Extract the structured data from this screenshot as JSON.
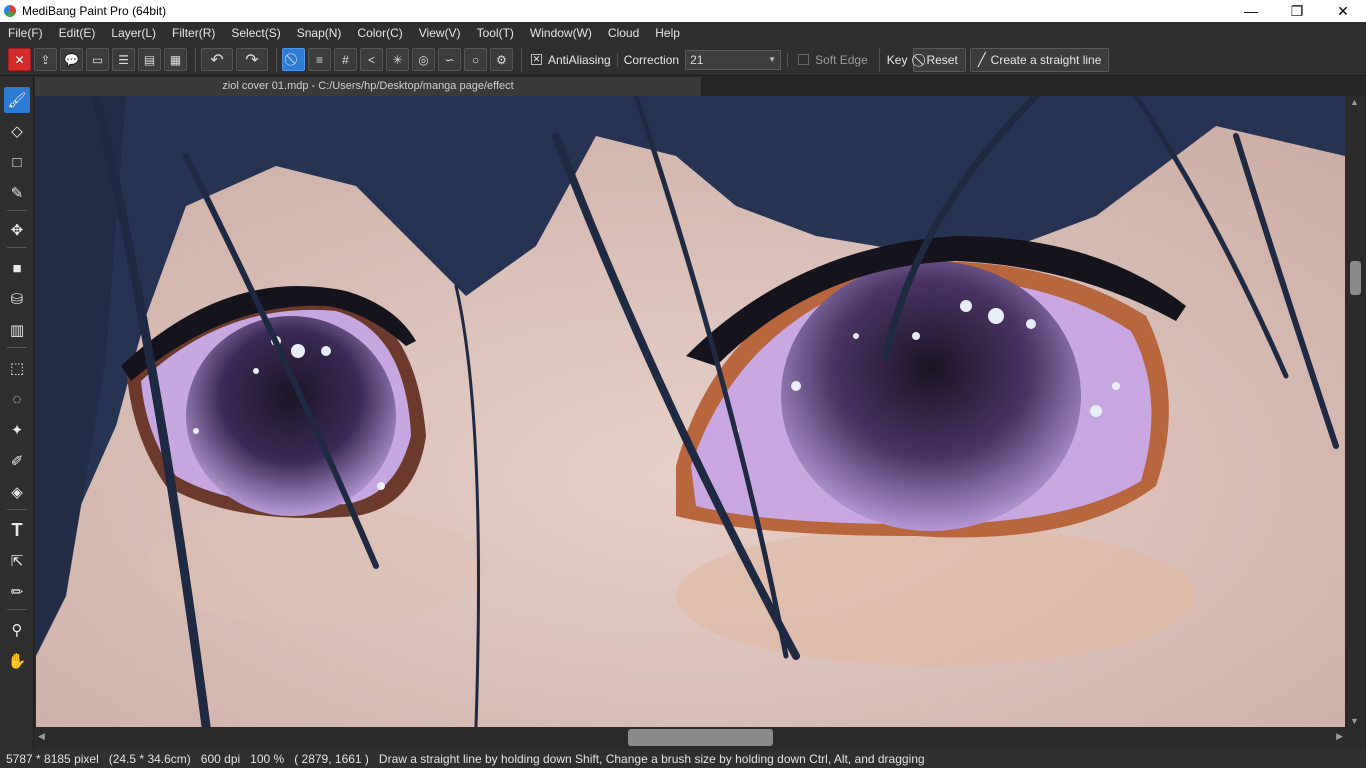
{
  "window": {
    "title": "MediBang Paint Pro (64bit)",
    "controls": {
      "minimize": "—",
      "restore": "❐",
      "close": "✕"
    }
  },
  "menu": [
    "File(F)",
    "Edit(E)",
    "Layer(L)",
    "Filter(R)",
    "Select(S)",
    "Snap(N)",
    "Color(C)",
    "View(V)",
    "Tool(T)",
    "Window(W)",
    "Cloud",
    "Help"
  ],
  "toolbar": {
    "antialiasing_label": "AntiAliasing",
    "antialiasing_checked": true,
    "correction_label": "Correction",
    "correction_value": "21",
    "soft_edge_label": "Soft Edge",
    "soft_edge_checked": false,
    "key_label": "Key",
    "reset_label": "Reset",
    "straight_line_label": "Create a straight line"
  },
  "document": {
    "tab_title": "ziol cover 01.mdp - C:/Users/hp/Desktop/manga page/effect"
  },
  "status": {
    "size_px": "5787 * 8185 pixel",
    "size_cm": "(24.5 * 34.6cm)",
    "dpi": "600 dpi",
    "zoom": "100 %",
    "cursor": "( 2879, 1661 )",
    "hint": "Draw a straight line by holding down Shift, Change a brush size by holding down Ctrl, Alt, and dragging"
  },
  "colors": {
    "accent": "#2e7bd6",
    "panel": "#2f2f2f",
    "hair": "#273352",
    "skin": "#d9c1b9",
    "iris": "#4a3463"
  }
}
